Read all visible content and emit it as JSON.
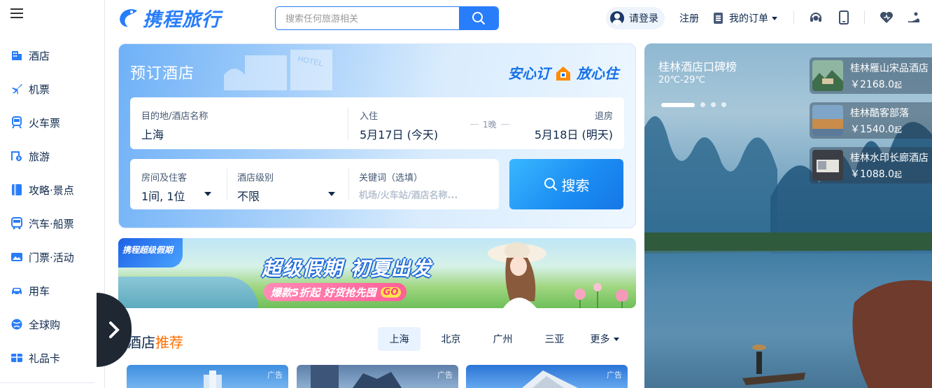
{
  "header": {
    "logo_text": "携程旅行",
    "search_placeholder": "搜索任何旅游相关",
    "login_label": "请登录",
    "register_label": "注册",
    "orders_label": "我的订单"
  },
  "sidebar": {
    "items": [
      {
        "label": "酒店",
        "icon": "hotel-icon"
      },
      {
        "label": "机票",
        "icon": "plane-icon"
      },
      {
        "label": "火车票",
        "icon": "train-icon"
      },
      {
        "label": "旅游",
        "icon": "travel-icon"
      },
      {
        "label": "攻略·景点",
        "icon": "guide-icon"
      },
      {
        "label": "汽车·船票",
        "icon": "bus-icon"
      },
      {
        "label": "门票·活动",
        "icon": "ticket-icon"
      },
      {
        "label": "用车",
        "icon": "car-icon"
      },
      {
        "label": "全球购",
        "icon": "globe-icon"
      },
      {
        "label": "礼品卡",
        "icon": "gift-card-icon"
      }
    ]
  },
  "hotel_booking": {
    "title": "预订酒店",
    "building_sign": "HOTEL",
    "slogan_left": "安心订",
    "slogan_right": "放心住",
    "destination_label": "目的地/酒店名称",
    "destination_value": "上海",
    "checkin_label": "入住",
    "checkin_value": "5月17日",
    "checkin_day": "(今天)",
    "nights": "1晚",
    "checkout_label": "退房",
    "checkout_value": "5月18日",
    "checkout_day": "(明天)",
    "guests_label": "房间及住客",
    "guests_value": "1间, 1位",
    "star_label": "酒店级别",
    "star_value": "不限",
    "keyword_label": "关键词（选填）",
    "keyword_placeholder": "机场/火车站/酒店名称...",
    "search_label": "搜索"
  },
  "banner": {
    "tag": "携程超级假期",
    "headline": "超级假期 初夏出发",
    "subline": "爆款5折起 好货抢先囤",
    "go": "GO"
  },
  "recommend": {
    "title_prefix": "酒店",
    "title_highlight": "推荐",
    "cities": [
      "上海",
      "北京",
      "广州",
      "三亚"
    ],
    "more_label": "更多",
    "ad_label": "广告"
  },
  "scenic": {
    "title": "桂林酒店口碑榜",
    "temperature": "20℃-29℃",
    "hotels": [
      {
        "name": "桂林雁山宋品酒店",
        "price": "￥2168.0",
        "suffix": "起"
      },
      {
        "name": "桂林酷客部落",
        "price": "￥1540.0",
        "suffix": "起"
      },
      {
        "name": "桂林水印长廊酒店",
        "price": "￥1088.0",
        "suffix": "起"
      }
    ]
  },
  "colors": {
    "brand": "#287dfa",
    "accent_orange": "#ff6f00",
    "text_primary": "#0f294d"
  }
}
